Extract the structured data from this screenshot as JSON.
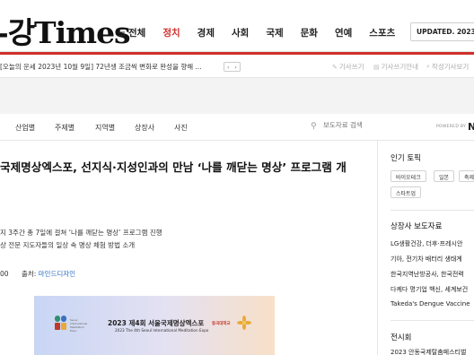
{
  "header": {
    "logo": "-강Times",
    "menu_icon": "hamburger-icon",
    "nav": [
      "전체",
      "정치",
      "경제",
      "사회",
      "국제",
      "문화",
      "연예",
      "스포츠"
    ],
    "active_nav": "정치",
    "updated": "UPDATED. 2023-10-0",
    "accent_color": "#d0302a"
  },
  "ticker": {
    "text": "[오늘의 운세 2023년 10월 9일] 72년생 조금씩 변화로 완성을 향해 ...",
    "prev": "‹",
    "next": "›",
    "links": [
      "기사쓰기",
      "기사쓰기안내",
      "작성기사보기"
    ]
  },
  "subnav": {
    "items": [
      "산업별",
      "주제별",
      "지역별",
      "상장사",
      "사진"
    ],
    "search_placeholder": "보도자료 검색",
    "powered_by": "POWERED BY",
    "powered_mark": "N"
  },
  "article": {
    "headline": "국제명상엑스포, 선지식·지성인과의 만남 ‘나를 깨닫는 명상’ 프로그램 개",
    "summary": [
      "지 3주간 총 7일에 걸쳐 ‘나를 깨닫는 명상’ 프로그램 진행",
      "상 전문 지도자들의 일상 속 명상 체험 방법 소개"
    ],
    "time_fragment": "00",
    "source_label": "출처:",
    "source_name": "마인드디자인"
  },
  "banner": {
    "title": "2023 제4회 서울국제명상엑스포",
    "subtitle": "2023 The 4th Seoul International Meditation Expo",
    "logo_caption": "Seoul International Meditation Expo",
    "university": "동국대학교"
  },
  "sidebar": {
    "popular_title": "인기 토픽",
    "topics": [
      "바이오테크",
      "일본",
      "축제",
      "스타트업"
    ],
    "press_title": "상장사 보도자료",
    "press_items": [
      "LG생활건강, 더후·프레시안 ",
      "기아, 전기차 배터리 생태계 ",
      "한국지역난방공사, 한국전력",
      "다케다 명기업 백신, 세계보건",
      "Takeda's Dengue Vaccine"
    ],
    "exhibition_title": "전시회",
    "exhibition_item": "2023 안동국제탈춤페스티벌"
  }
}
